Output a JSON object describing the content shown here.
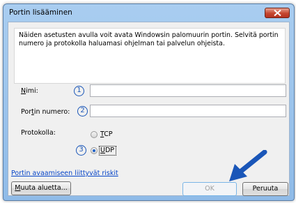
{
  "window": {
    "title": "Portin lisääminen"
  },
  "description": "Näiden asetusten avulla voit avata Windowsin palomuurin portin. Selvitä portin numero ja protokolla haluamasi ohjelman tai palvelun ohjeista.",
  "fields": {
    "name_label": "Nimi:",
    "port_label": "Portin numero:",
    "name_value": "",
    "port_value": ""
  },
  "protocol": {
    "label": "Protokolla:",
    "options": [
      "TCP",
      "UDP"
    ],
    "selected": "UDP"
  },
  "callouts": [
    "1",
    "2",
    "3"
  ],
  "link_text": "Portin avaamiseen liittyvät riskit",
  "buttons": {
    "change_scope": "Muuta aluetta...",
    "ok": "OK",
    "cancel": "Peruuta"
  },
  "colors": {
    "callout": "#1a56b8",
    "arrow": "#1a56b8",
    "link": "#0645c8"
  }
}
